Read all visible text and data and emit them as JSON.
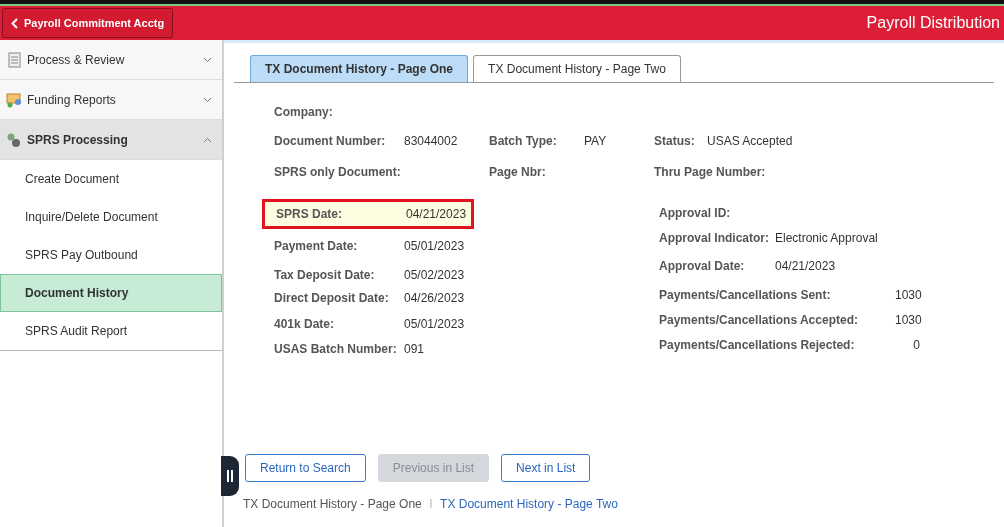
{
  "header": {
    "back_button": "Payroll Commitment Acctg",
    "title": "Payroll Distribution"
  },
  "sidebar": {
    "groups": [
      {
        "label": "Process & Review",
        "expanded": false
      },
      {
        "label": "Funding Reports",
        "expanded": false
      },
      {
        "label": "SPRS Processing",
        "expanded": true,
        "children": [
          {
            "label": "Create Document",
            "selected": false
          },
          {
            "label": "Inquire/Delete Document",
            "selected": false
          },
          {
            "label": "SPRS Pay Outbound",
            "selected": false
          },
          {
            "label": "Document History",
            "selected": true
          },
          {
            "label": "SPRS Audit Report",
            "selected": false
          }
        ]
      }
    ]
  },
  "tabs": [
    {
      "label": "TX Document History - Page One",
      "selected": true
    },
    {
      "label": "TX Document History - Page Two",
      "selected": false
    }
  ],
  "company": {
    "label": "Company:"
  },
  "header_rows": [
    [
      {
        "label": "Document Number:",
        "value": "83044002"
      },
      {
        "label": "Batch Type:",
        "value": "PAY"
      },
      {
        "label": "Status:",
        "value": "USAS Accepted"
      }
    ],
    [
      {
        "label": "SPRS only Document:"
      },
      {
        "label": "Page Nbr:"
      },
      {
        "label": "Thru Page Number:"
      }
    ]
  ],
  "dates": [
    {
      "label": "SPRS Date:",
      "value": "04/21/2023",
      "highlighted": true
    },
    {
      "label": "Payment Date:",
      "value": "05/01/2023",
      "highlighted": false
    },
    {
      "label": "Tax Deposit Date:",
      "value": "05/02/2023",
      "highlighted": false
    },
    {
      "label": "Direct Deposit Date:",
      "value": "04/26/2023",
      "highlighted": false
    },
    {
      "label": "401k Date:",
      "value": "05/01/2023",
      "highlighted": false
    },
    {
      "label": "USAS Batch Number:",
      "value": "091",
      "highlighted": false
    }
  ],
  "approval": [
    {
      "label": "Approval ID:",
      "kind": "short"
    },
    {
      "label": "Approval Indicator:",
      "value": "Electronic Approval",
      "kind": "short"
    },
    {
      "label": "Approval Date:",
      "value": "04/21/2023",
      "kind": "short"
    },
    {
      "label": "Payments/Cancellations Sent:",
      "value": "1030",
      "kind": "count"
    },
    {
      "label": "Payments/Cancellations Accepted:",
      "value": "1030",
      "kind": "count"
    },
    {
      "label": "Payments/Cancellations Rejected:",
      "value": "0",
      "kind": "count"
    }
  ],
  "buttons": [
    {
      "label": "Return to Search",
      "disabled": false
    },
    {
      "label": "Previous in List",
      "disabled": true
    },
    {
      "label": "Next in List",
      "disabled": false
    }
  ],
  "footer_links": [
    {
      "label": "TX Document History - Page One",
      "selected": true
    },
    {
      "label": "TX Document History - Page Two",
      "selected": false
    }
  ],
  "footer_separator": "|"
}
